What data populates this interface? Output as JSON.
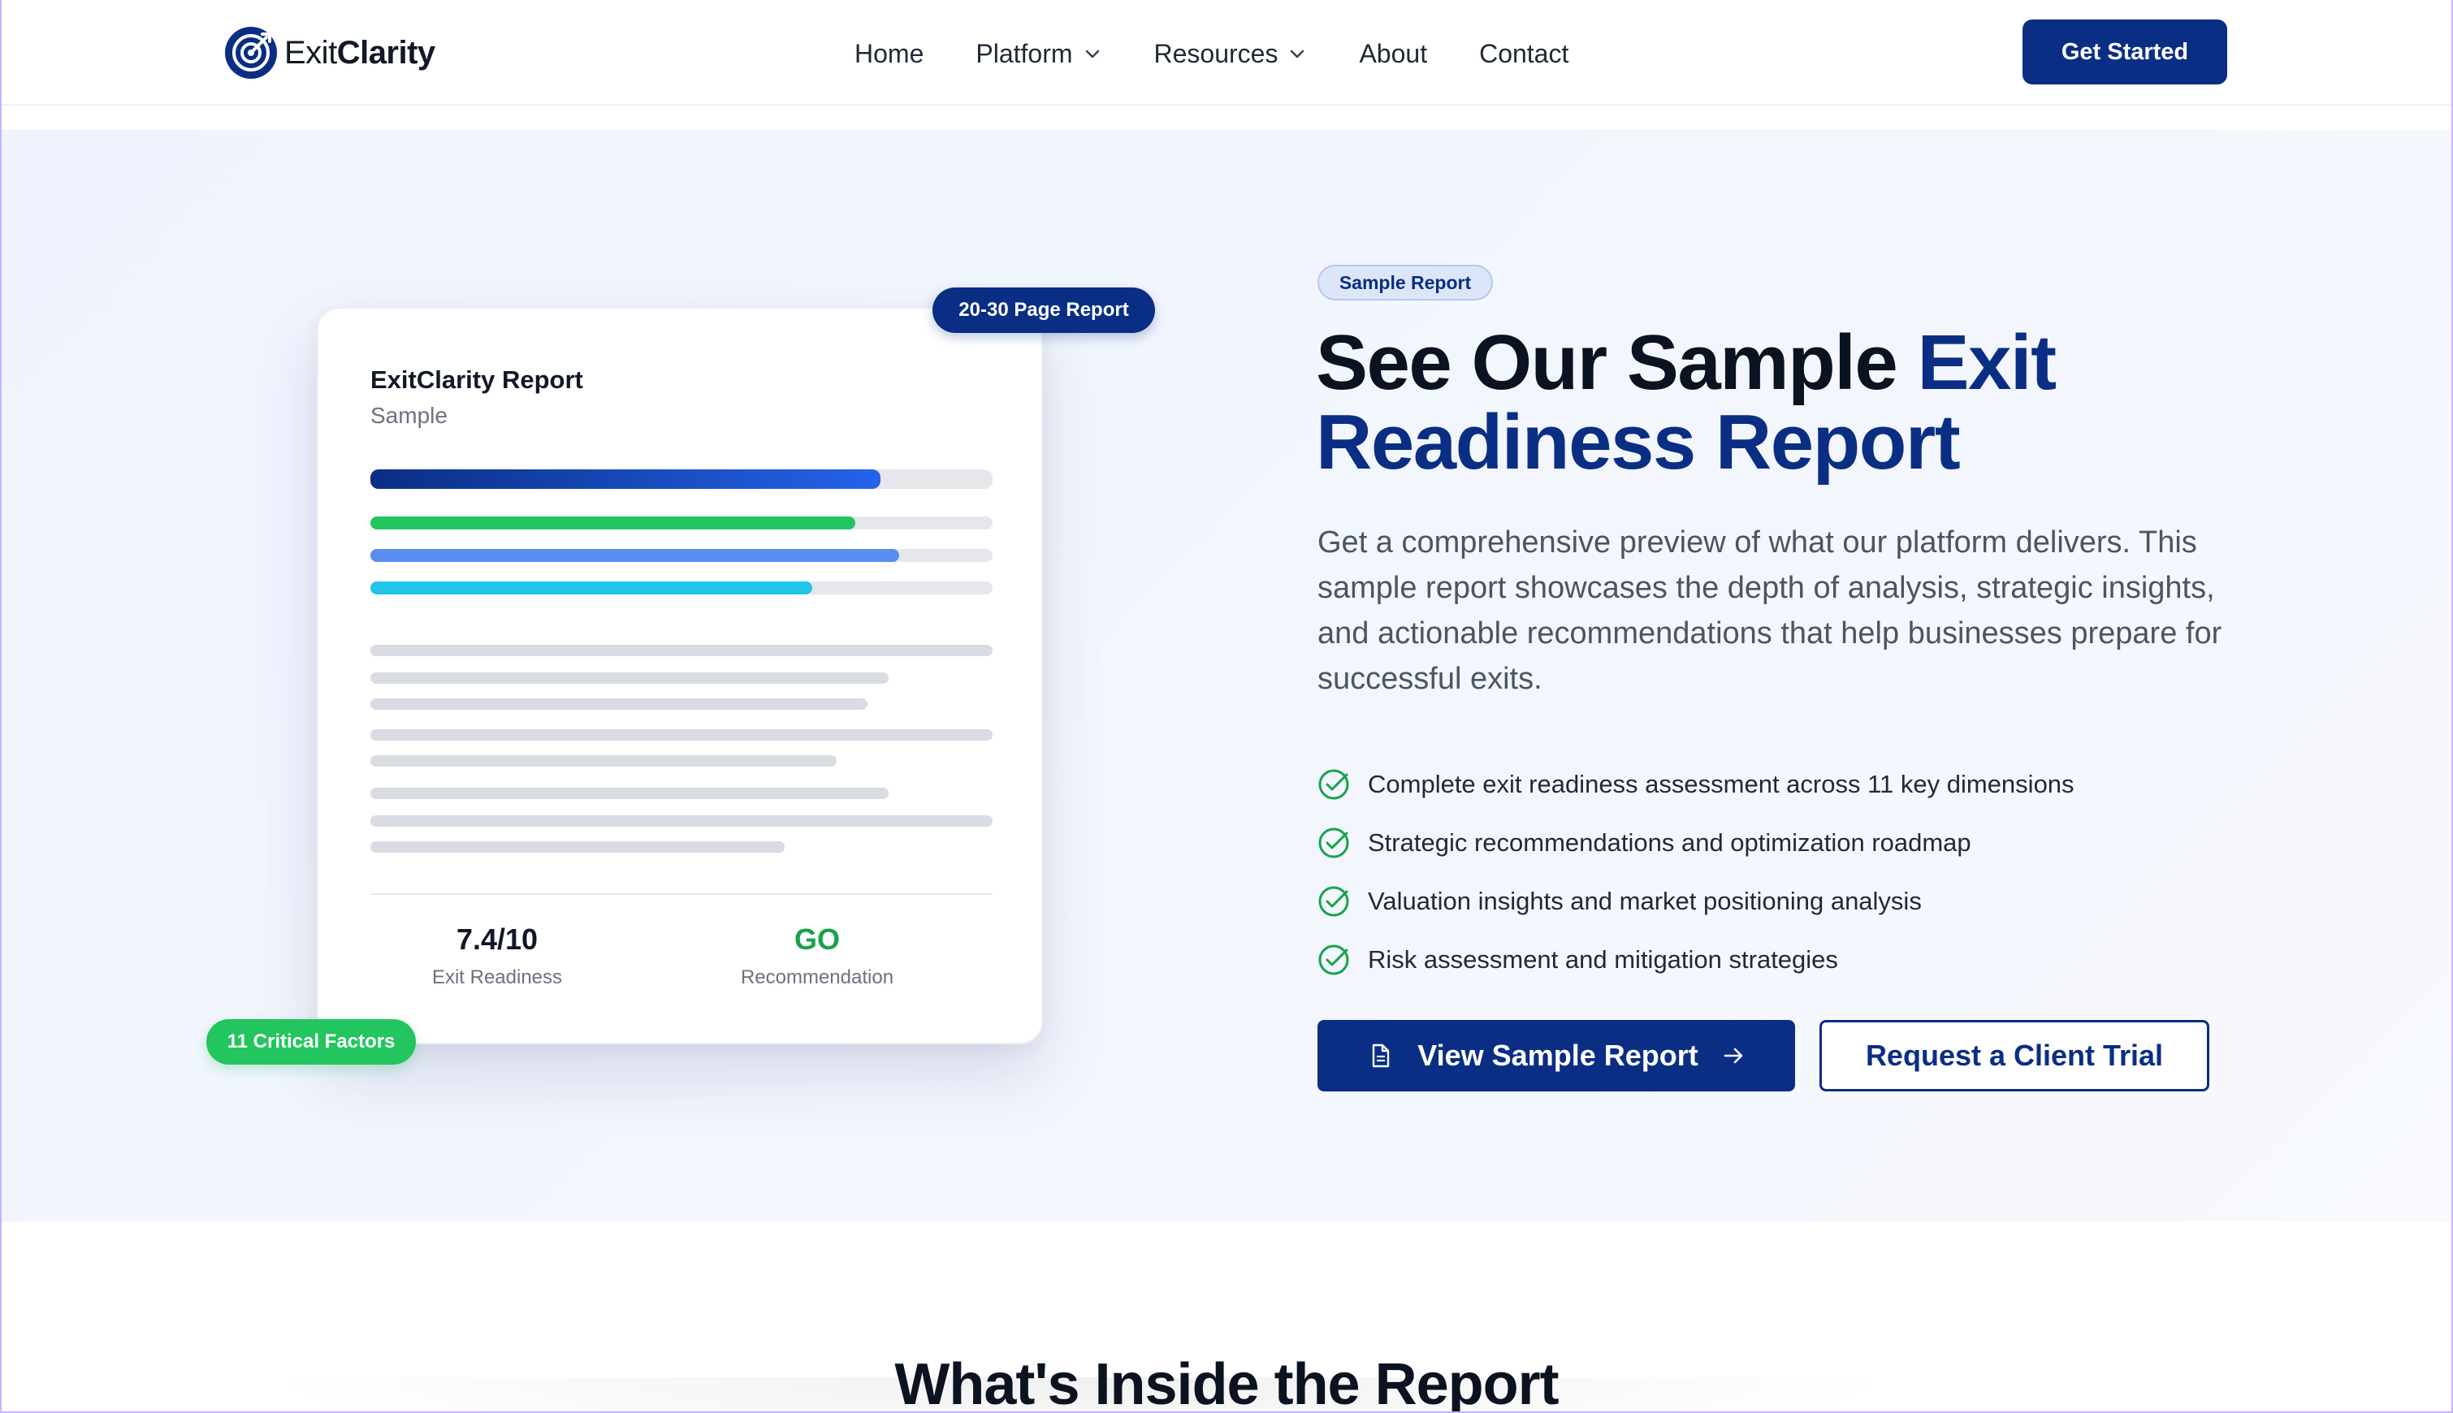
{
  "brand": {
    "name_light": "Exit",
    "name_bold": "Clarity",
    "primary_color": "#0a2e84",
    "success_color": "#22c55e"
  },
  "nav": {
    "items": [
      {
        "label": "Home",
        "has_dropdown": false
      },
      {
        "label": "Platform",
        "has_dropdown": true
      },
      {
        "label": "Resources",
        "has_dropdown": true
      },
      {
        "label": "About",
        "has_dropdown": false
      },
      {
        "label": "Contact",
        "has_dropdown": false
      }
    ],
    "cta_label": "Get Started"
  },
  "preview": {
    "title": "ExitClarity Report",
    "subtitle": "Sample",
    "pages_badge": "20-30 Page Report",
    "factors_badge": "11 Critical Factors",
    "progress_bars": [
      {
        "fill": 0.82,
        "color": "#1d4ed8"
      },
      {
        "fill": 0.78,
        "color": "#22c55e"
      },
      {
        "fill": 0.85,
        "color": "#60a5fa"
      },
      {
        "fill": 0.71,
        "color": "#22d3ee"
      }
    ],
    "stats": [
      {
        "value": "7.4/10",
        "label": "Exit Readiness"
      },
      {
        "value": "GO",
        "label": "Recommendation"
      }
    ]
  },
  "hero": {
    "tag": "Sample Report",
    "headline_plain": "See Our Sample ",
    "headline_accent_1": "Exit",
    "headline_accent_2": "Readiness Report",
    "lead": "Get a comprehensive preview of what our platform delivers. This sample report showcases the depth of analysis, strategic insights, and actionable recommendations that help businesses prepare for successful exits.",
    "features": [
      "Complete exit readiness assessment across 11 key dimensions",
      "Strategic recommendations and optimization roadmap",
      "Valuation insights and market positioning analysis",
      "Risk assessment and mitigation strategies"
    ],
    "primary_button": "View Sample Report",
    "secondary_button": "Request a Client Trial"
  },
  "next_section": {
    "title": "What's Inside the Report"
  }
}
